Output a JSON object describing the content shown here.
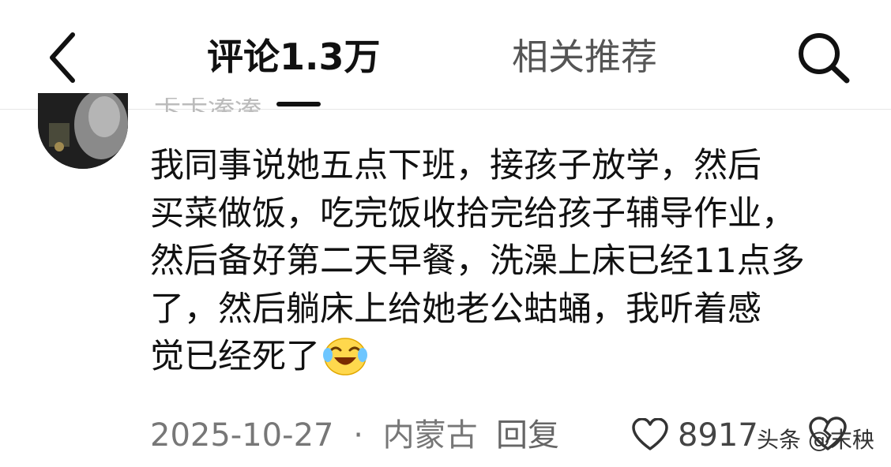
{
  "header": {
    "back_icon": "chevron-left-icon",
    "tab_comments": "评论1.3万",
    "tab_related": "相关推荐",
    "search_icon": "search-icon"
  },
  "comment": {
    "username": "卡卡溱溱",
    "lines": [
      "我同事说她五点下班，接孩子放学，然后",
      "买菜做饭，吃完饭收拾完给孩子辅导作业，",
      "然后备好第二天早餐，洗澡上床已经11点多",
      "了，然后躺床上给她老公蛄蛹，我听着感",
      "觉已经死了"
    ],
    "emoji": "crying-laughing-emoji-icon",
    "date": "2025-10-27",
    "separator": "·",
    "location": "内蒙古",
    "reply_label": "回复",
    "like_count": "8917"
  },
  "watermark": "头条 @末秧",
  "colors": {
    "accent": "#111111",
    "muted": "#777777",
    "emoji": "#ffd84d"
  }
}
